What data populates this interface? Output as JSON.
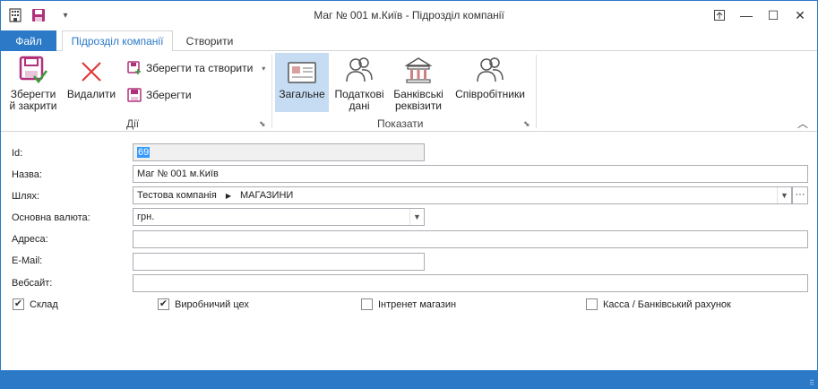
{
  "window": {
    "title": "Маг № 001 м.Київ - Підрозділ компанії"
  },
  "quick_access": {
    "customize_glyph": "▾"
  },
  "window_controls": {
    "pin": "⤒",
    "minimize": "—",
    "maximize": "☐",
    "close": "✕"
  },
  "tabs": {
    "file": "Файл",
    "items": [
      "Підрозділ компанії",
      "Створити"
    ]
  },
  "ribbon": {
    "actions": {
      "save_close": "Зберегти й закрити",
      "delete": "Видалити",
      "save_create": "Зберегти та створити",
      "save": "Зберегти",
      "group_label": "Дії"
    },
    "show": {
      "general": "Загальне",
      "tax": "Податкові дані",
      "bank": "Банківські реквізити",
      "staff": "Співробітники",
      "group_label": "Показати"
    }
  },
  "form": {
    "id": {
      "label": "Id:",
      "value": "69"
    },
    "name": {
      "label": "Назва:",
      "value": "Маг № 001 м.Київ"
    },
    "path": {
      "label": "Шлях:",
      "parts": [
        "Тестова компанія",
        "МАГАЗИНИ"
      ],
      "more": "···"
    },
    "currency": {
      "label": "Основна валюта:",
      "value": "грн."
    },
    "address": {
      "label": "Адреса:",
      "value": ""
    },
    "email": {
      "label": "E-Mail:",
      "value": ""
    },
    "website": {
      "label": "Вебсайт:",
      "value": ""
    },
    "checkboxes": [
      {
        "label": "Склад",
        "checked": true
      },
      {
        "label": "Виробничий цех",
        "checked": true
      },
      {
        "label": "Інтренет магазин",
        "checked": false
      },
      {
        "label": "Касса / Банківський рахунок",
        "checked": false
      }
    ]
  },
  "colors": {
    "accent": "#2b79c7",
    "selected_ribbon": "#c5dcf2",
    "delete_red": "#e03a3a",
    "save_purple": "#b0307a"
  }
}
